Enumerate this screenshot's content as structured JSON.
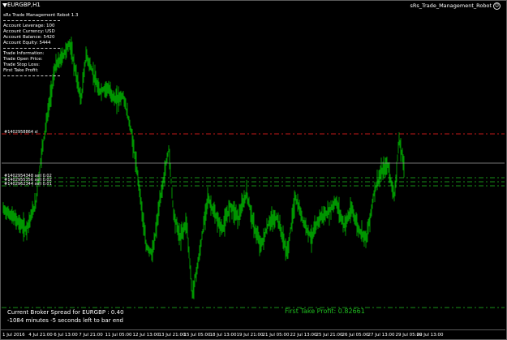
{
  "window": {
    "title": "EURGBP,H1",
    "ea_name": "sRs_Trade_Management_Robot",
    "ea_status_icon": "smiley-face-icon"
  },
  "info_panel": {
    "title": "sRs Trade Management Robot 1.3",
    "account_leverage": "Account Leverage:  100",
    "account_currency": "Account Currency:  USD",
    "account_balance": "Account Balance:    5420",
    "account_equity": "Account Equity:      5444",
    "trade_information": "Trade Information:",
    "trade_open_price": "Trade Open Price:",
    "trade_stop_loss": "Trade Stop Loss:",
    "first_take_profit": "First Take Profit:"
  },
  "order_labels": {
    "sl": "#1402958864 sl",
    "sell1": "#1402954348 sell 0.02",
    "sell2": "#1402955356 sell 0.02",
    "sell3": "#1402962344 sell 0.01"
  },
  "status": {
    "spread": "Current Broker Spread for EURGBP : 0.40",
    "time_left": "-1084 minutes -5 seconds left to bar end",
    "first_take_profit": "First Take Profit: 0.82661"
  },
  "x_axis": [
    "1 Jul 2016",
    "4 Jul 21:00",
    "6 Jul 13:00",
    "7 Jul 21:00",
    "11 Jul 05:00",
    "12 Jul 13:00",
    "13 Jul 21:00",
    "15 Jul 05:00",
    "18 Jul 13:00",
    "19 Jul 21:00",
    "21 Jul 05:00",
    "22 Jul 13:00",
    "25 Jul 21:00",
    "26 Jul 05:00",
    "27 Jul 13:00",
    "29 Jul 05:00",
    "29 Jul 13:00"
  ],
  "colors": {
    "background": "#000000",
    "candles": "#00a800",
    "sl_line": "#ff2020",
    "order_lines": "#1fbf1f",
    "current_price_line": "#9a9a9a"
  }
}
